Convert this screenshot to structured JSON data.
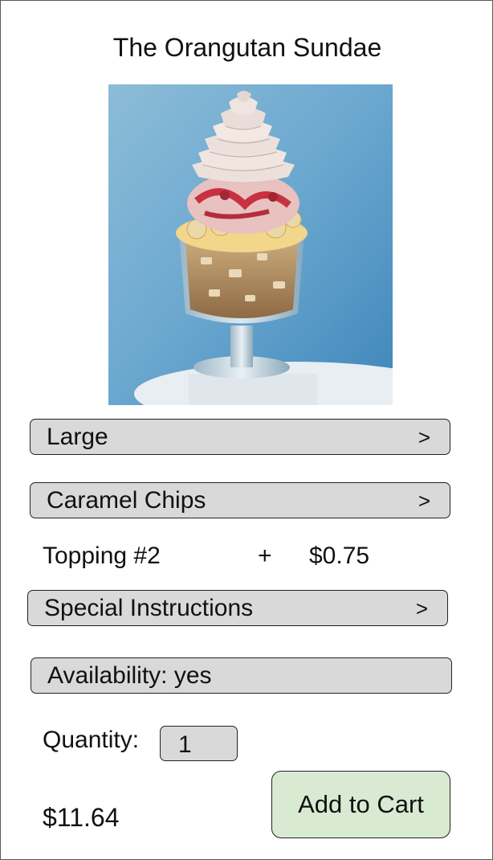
{
  "product": {
    "title": "The Orangutan Sundae"
  },
  "options": {
    "size": {
      "label": "Large",
      "arrow": ">"
    },
    "topping": {
      "label": "Caramel Chips",
      "arrow": ">"
    },
    "instructions": {
      "label": "Special Instructions",
      "arrow": ">"
    },
    "availability": {
      "label": "Availability: yes"
    }
  },
  "topping_line": {
    "name": "Topping #2",
    "plus": "+",
    "price": "$0.75"
  },
  "quantity": {
    "label": "Quantity:",
    "value": "1"
  },
  "cart": {
    "total": "$11.64",
    "add_label": "Add to Cart"
  },
  "colors": {
    "option_bar": "#d9d9d9",
    "add_button": "#d9ead3",
    "border": "#222222"
  }
}
